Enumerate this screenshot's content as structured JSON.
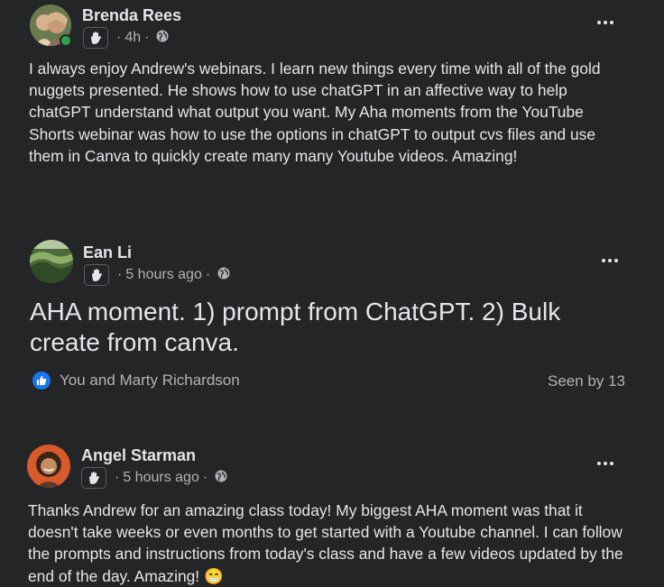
{
  "posts": [
    {
      "author": "Brenda Rees",
      "time": "4h",
      "text": "I always enjoy Andrew's webinars.  I learn new things every time with all of the gold nuggets presented.  He shows how to use chatGPT in an affective way to help chatGPT understand what output you want.  My Aha moments from the YouTube Shorts webinar was how to use the options in chatGPT to output cvs files and use them in Canva to quickly create many many Youtube videos. Amazing!",
      "online": true
    },
    {
      "author": "Ean Li",
      "time": "5 hours ago",
      "text": "AHA moment. 1) prompt from ChatGPT. 2) Bulk create from canva.",
      "reactions": "You and Marty Richardson",
      "seen": "Seen by 13"
    },
    {
      "author": "Angel Starman",
      "time": "5 hours ago",
      "text": "Thanks Andrew for an amazing class today! My biggest AHA moment was that it doesn't take weeks or even months to get started with a Youtube channel. I can follow the prompts and instructions from today's class and have a few videos updated by the end of the day. Amazing!",
      "emoji": "😁"
    }
  ],
  "meta_separator": "·",
  "icons": {
    "badge": "wave-badge-icon",
    "audience": "globe-icon",
    "more": "more-options-icon",
    "like": "like-icon"
  },
  "colors": {
    "background": "#242526",
    "text": "#e4e6eb",
    "secondary": "#b0b3b8",
    "like": "#1877f2",
    "online": "#31a24c"
  }
}
